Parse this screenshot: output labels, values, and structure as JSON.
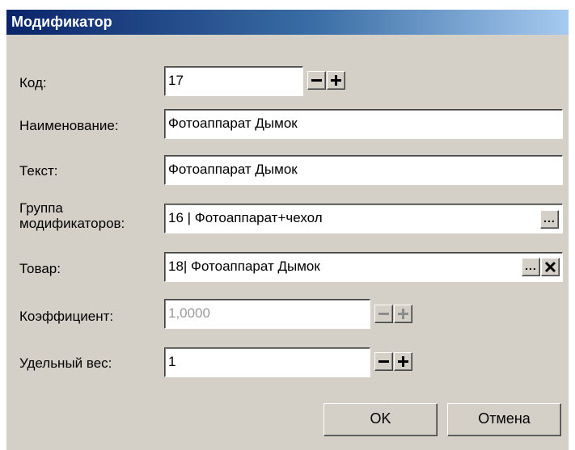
{
  "window": {
    "title": "Модификатор"
  },
  "fields": {
    "code": {
      "label": "Код:",
      "value": "17"
    },
    "name": {
      "label": "Наименование:",
      "value": "Фотоаппарат Дымок"
    },
    "text": {
      "label": "Текст:",
      "value": "Фотоаппарат Дымок"
    },
    "group": {
      "label_line1": "Группа",
      "label_line2": "модификаторов:",
      "value": "16 | Фотоаппарат+чехол",
      "browse": "..."
    },
    "product": {
      "label": "Товар:",
      "value": "18| Фотоаппарат Дымок",
      "browse": "..."
    },
    "coefficient": {
      "label": "Коэффициент:",
      "value": "1,0000"
    },
    "weight": {
      "label": "Удельный вес:",
      "value": "1"
    }
  },
  "buttons": {
    "ok": "OK",
    "cancel": "Отмена"
  },
  "icons": {
    "minus": "minus-icon",
    "plus": "plus-icon",
    "clear": "close-icon"
  },
  "colors": {
    "dialog_bg": "#d4d0c8",
    "title_start": "#0a246a",
    "title_end": "#a6caf0",
    "disabled_text": "#9a9a9a"
  }
}
